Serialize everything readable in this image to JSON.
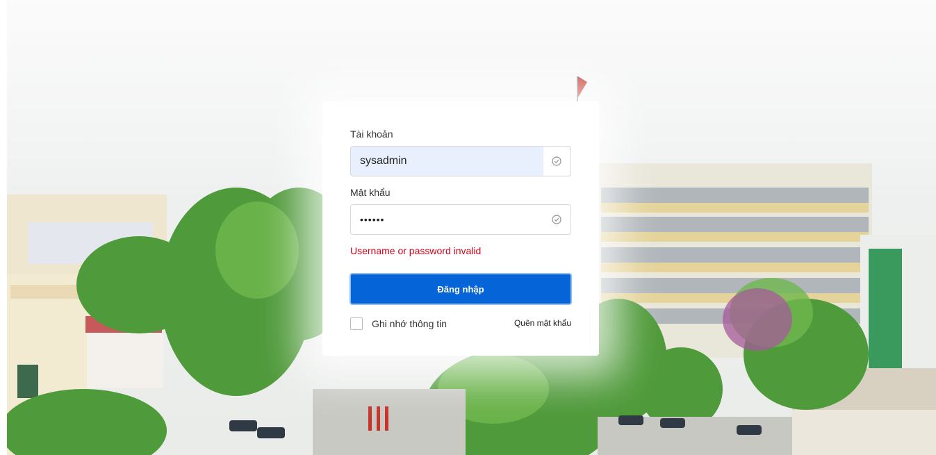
{
  "login_form": {
    "username_label": "Tài khoản",
    "username_value": "sysadmin",
    "password_label": "Mật khẩu",
    "password_value": "••••••",
    "error_message": "Username or password invalid",
    "submit_label": "Đăng nhập",
    "remember_label": "Ghi nhớ thông tin",
    "remember_checked": false,
    "forgot_label": "Quên mật khẩu"
  },
  "colors": {
    "primary": "#0565d8",
    "error": "#d0021b",
    "autofill_bg": "#e8f0fe"
  },
  "icons": {
    "username_status": "check-circle-icon",
    "password_status": "check-circle-icon"
  }
}
